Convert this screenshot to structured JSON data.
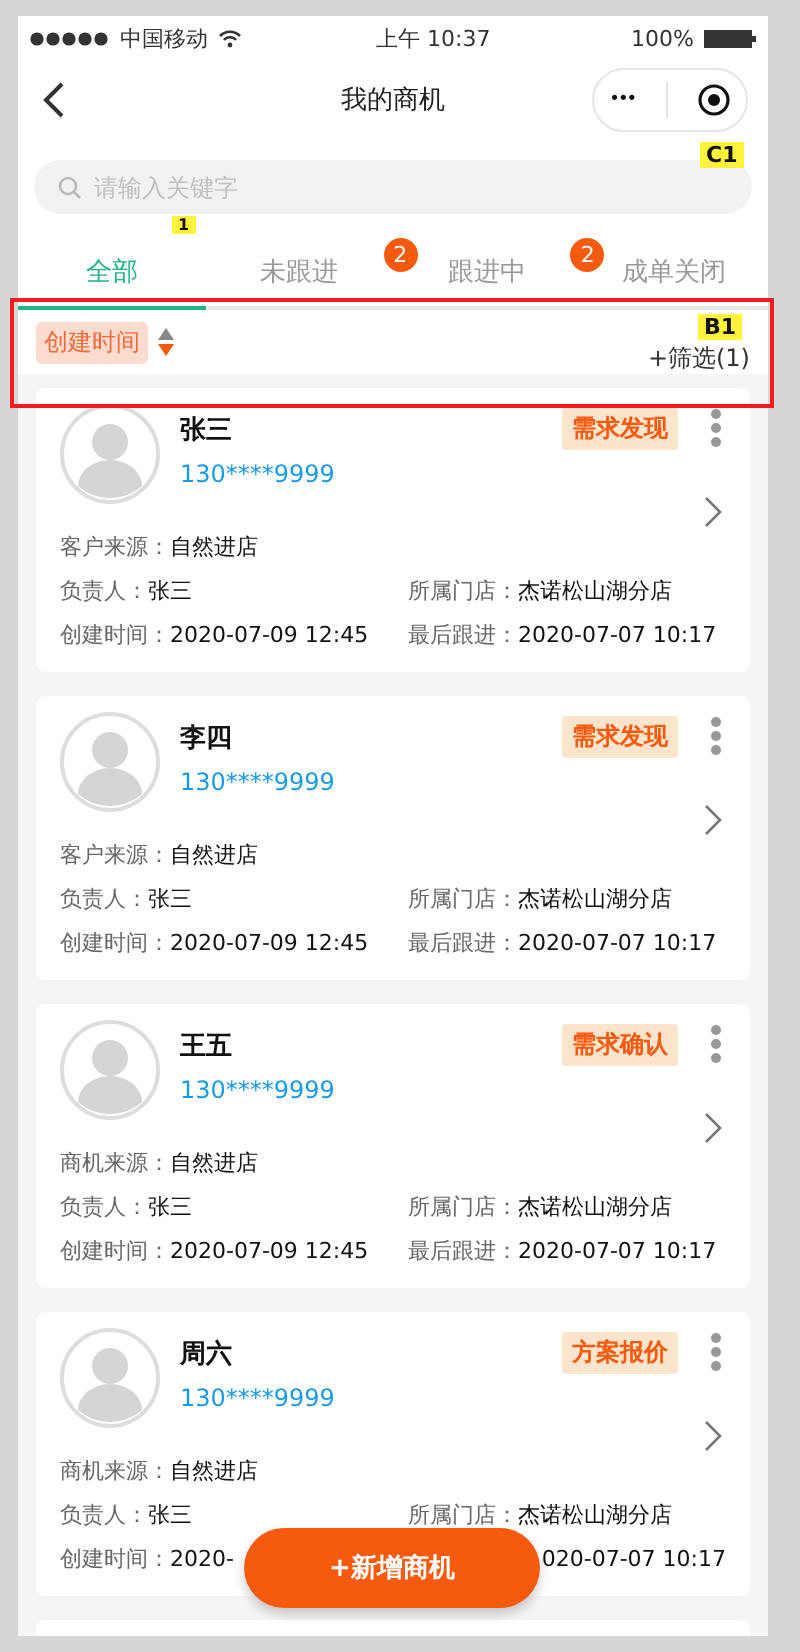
{
  "status_bar": {
    "carrier": "中国移动",
    "time": "上午 10:37",
    "battery": "100%"
  },
  "nav": {
    "title": "我的商机",
    "menu": "•••"
  },
  "search": {
    "placeholder": "请输入关键字"
  },
  "tabs": [
    {
      "label": "全部",
      "selected": true
    },
    {
      "label": "未跟进",
      "selected": false,
      "badge": "2"
    },
    {
      "label": "跟进中",
      "selected": false,
      "badge": "2"
    },
    {
      "label": "成单关闭",
      "selected": false
    }
  ],
  "sort": {
    "label": "创建时间",
    "filter": "+筛选(1)"
  },
  "cards": [
    {
      "name": "张三",
      "phone": "130****9999",
      "status": "需求发现",
      "rows": [
        [
          {
            "label": "客户来源：",
            "value": "自然进店"
          }
        ],
        [
          {
            "label": "负责人：",
            "value": "张三"
          },
          {
            "label": "所属门店：",
            "value": "杰诺松山湖分店"
          }
        ],
        [
          {
            "label": "创建时间：",
            "value": "2020-07-09 12:45"
          },
          {
            "label": "最后跟进：",
            "value": "2020-07-07 10:17"
          }
        ]
      ]
    },
    {
      "name": "李四",
      "phone": "130****9999",
      "status": "需求发现",
      "rows": [
        [
          {
            "label": "客户来源：",
            "value": "自然进店"
          }
        ],
        [
          {
            "label": "负责人：",
            "value": "张三"
          },
          {
            "label": "所属门店：",
            "value": "杰诺松山湖分店"
          }
        ],
        [
          {
            "label": "创建时间：",
            "value": "2020-07-09 12:45"
          },
          {
            "label": "最后跟进：",
            "value": "2020-07-07 10:17"
          }
        ]
      ]
    },
    {
      "name": "王五",
      "phone": "130****9999",
      "status": "需求确认",
      "rows": [
        [
          {
            "label": "商机来源：",
            "value": "自然进店"
          }
        ],
        [
          {
            "label": "负责人：",
            "value": "张三"
          },
          {
            "label": "所属门店：",
            "value": "杰诺松山湖分店"
          }
        ],
        [
          {
            "label": "创建时间：",
            "value": "2020-07-09 12:45"
          },
          {
            "label": "最后跟进：",
            "value": "2020-07-07 10:17"
          }
        ]
      ]
    },
    {
      "name": "周六",
      "phone": "130****9999",
      "status": "方案报价",
      "rows": [
        [
          {
            "label": "商机来源：",
            "value": "自然进店"
          }
        ],
        [
          {
            "label": "负责人：",
            "value": "张三"
          },
          {
            "label": "所属门店：",
            "value": "杰诺松山湖分店"
          }
        ],
        [
          {
            "label": "创建时间：",
            "value": "2020-"
          },
          {
            "value": "020-07-07 10:17"
          }
        ]
      ]
    }
  ],
  "add_button": "+新增商机",
  "annotations": [
    {
      "label": "C1",
      "kind": "tag"
    },
    {
      "label": "1",
      "kind": "tag"
    },
    {
      "label": "B1",
      "kind": "tag"
    }
  ]
}
